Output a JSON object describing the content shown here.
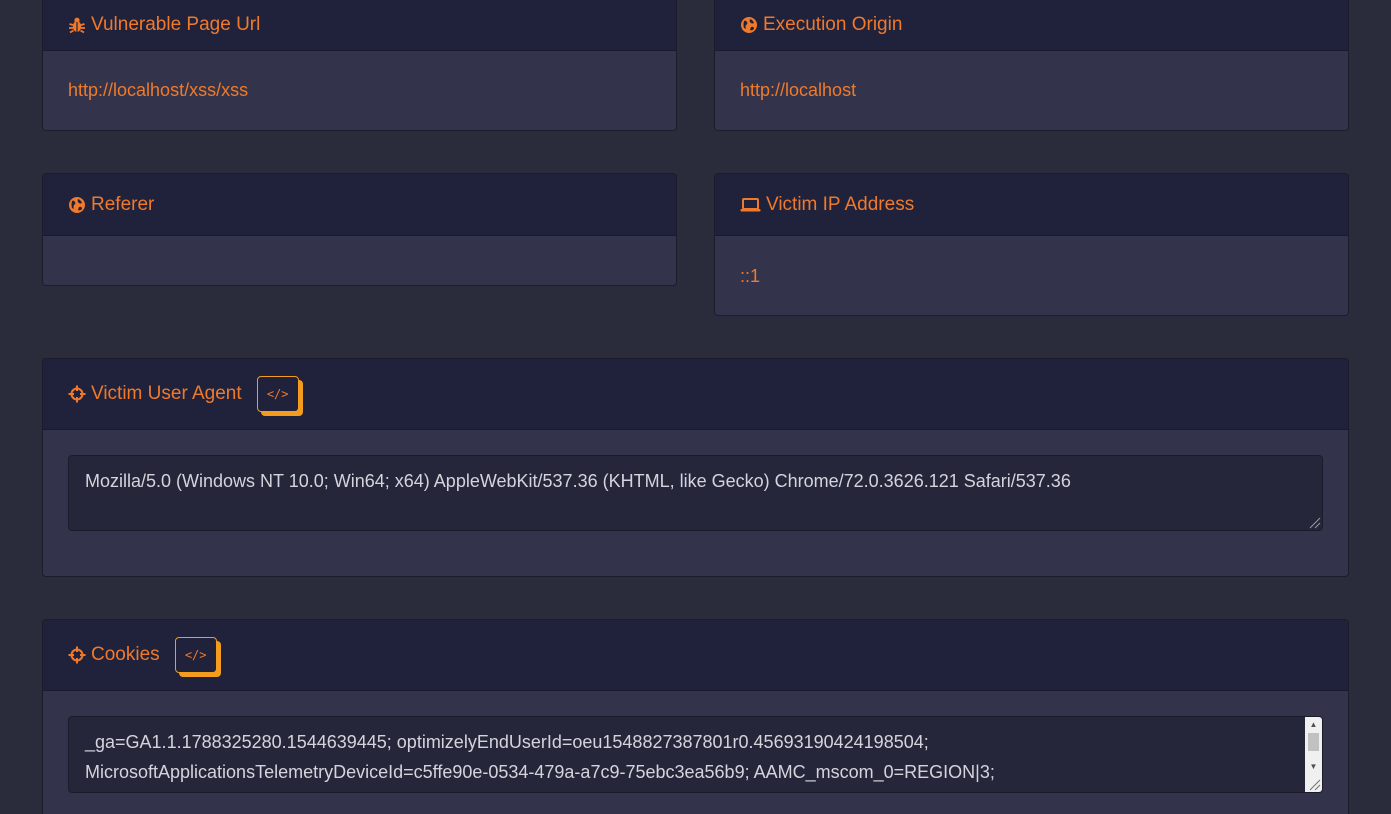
{
  "cards": {
    "vulnerable_url": {
      "title": "Vulnerable Page Url",
      "value": "http://localhost/xss/xss"
    },
    "execution_origin": {
      "title": "Execution Origin",
      "value": "http://localhost"
    },
    "referer": {
      "title": "Referer",
      "value": ""
    },
    "victim_ip": {
      "title": "Victim IP Address",
      "value": "::1"
    },
    "user_agent": {
      "title": "Victim User Agent",
      "button_label": "</>",
      "value": "Mozilla/5.0 (Windows NT 10.0; Win64; x64) AppleWebKit/537.36 (KHTML, like Gecko) Chrome/72.0.3626.121 Safari/537.36"
    },
    "cookies": {
      "title": "Cookies",
      "button_label": "</>",
      "line1": "_ga=GA1.1.1788325280.1544639445; optimizelyEndUserId=oeu1548827387801r0.45693190424198504;",
      "line2": "MicrosoftApplicationsTelemetryDeviceId=c5ffe90e-0534-479a-a7c9-75ebc3ea56b9; AAMC_mscom_0=REGION|3;"
    }
  },
  "icons": {
    "vulnerable_url": "bug-icon",
    "execution_origin": "globe-icon",
    "referer": "globe-icon",
    "victim_ip": "laptop-icon",
    "user_agent": "crosshairs-icon",
    "cookies": "crosshairs-icon"
  },
  "colors": {
    "accent": "#f07a2b",
    "button_shadow": "#f39c1e",
    "card_bg": "#33344b",
    "header_bg": "#20213a",
    "page_bg": "#2a2c3b"
  }
}
